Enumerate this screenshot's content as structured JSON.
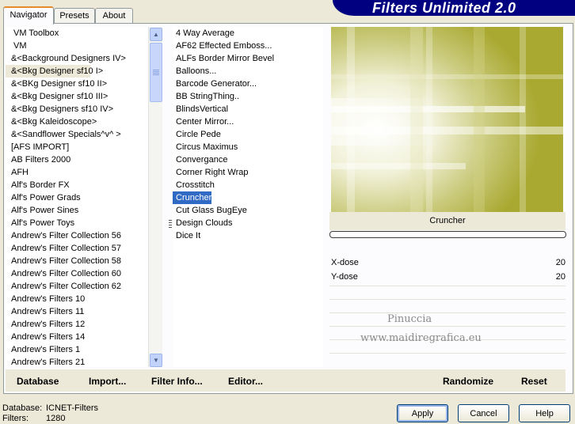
{
  "window": {
    "banner_title": "Filters Unlimited 2.0"
  },
  "tabs": [
    "Navigator",
    "Presets",
    "About"
  ],
  "categories": [
    "VM Toolbox",
    "VM",
    "&<Background Designers IV>",
    "&<Bkg Designer sf10 I>",
    "&<BKg Designer sf10 II>",
    "&<Bkg Designer sf10 III>",
    "&<Bkg Designers sf10 IV>",
    "&<Bkg Kaleidoscope>",
    "&<Sandflower Specials^v^ >",
    "[AFS IMPORT]",
    "AB Filters 2000",
    "AFH",
    "Alf's Border FX",
    "Alf's Power Grads",
    "Alf's Power Sines",
    "Alf's Power Toys",
    "Andrew's Filter Collection 56",
    "Andrew's Filter Collection 57",
    "Andrew's Filter Collection 58",
    "Andrew's Filter Collection 60",
    "Andrew's Filter Collection 62",
    "Andrew's Filters 10",
    "Andrew's Filters 11",
    "Andrew's Filters 12",
    "Andrew's Filters 14",
    "Andrew's Filters 1",
    "Andrew's Filters 21"
  ],
  "selected_category": "&<Bkg Designer sf10 I>",
  "filters": [
    "4 Way Average",
    "AF62 Effected Emboss...",
    "ALFs Border Mirror Bevel",
    "Balloons...",
    "Barcode Generator...",
    "BB StringThing..",
    "BlindsVertical",
    "Center Mirror...",
    "Circle Pede",
    "Circus Maximus",
    "Convergance",
    "Corner Right Wrap",
    "Crosstitch",
    "Cruncher",
    "Cut Glass  BugEye",
    "Design Clouds",
    "Dice It"
  ],
  "selected_filter": "Cruncher",
  "preview": {
    "filter_name": "Cruncher",
    "accent_color": "#b5b542",
    "progress": 0
  },
  "params": [
    {
      "label": "X-dose",
      "value": "20"
    },
    {
      "label": "Y-dose",
      "value": "20"
    }
  ],
  "watermark": {
    "line1": "Pinuccia",
    "line2": "www.maidiregrafica.eu"
  },
  "commands": {
    "database": "Database",
    "import": "Import...",
    "filter_info": "Filter Info...",
    "editor": "Editor...",
    "randomize": "Randomize",
    "reset": "Reset"
  },
  "status": {
    "database_label": "Database:",
    "database_value": "ICNET-Filters",
    "filters_label": "Filters:",
    "filters_value": "1280"
  },
  "buttons": {
    "apply": "Apply",
    "cancel": "Cancel",
    "help": "Help"
  },
  "scroll_arrows": {
    "up": "▲",
    "down": "▼"
  }
}
